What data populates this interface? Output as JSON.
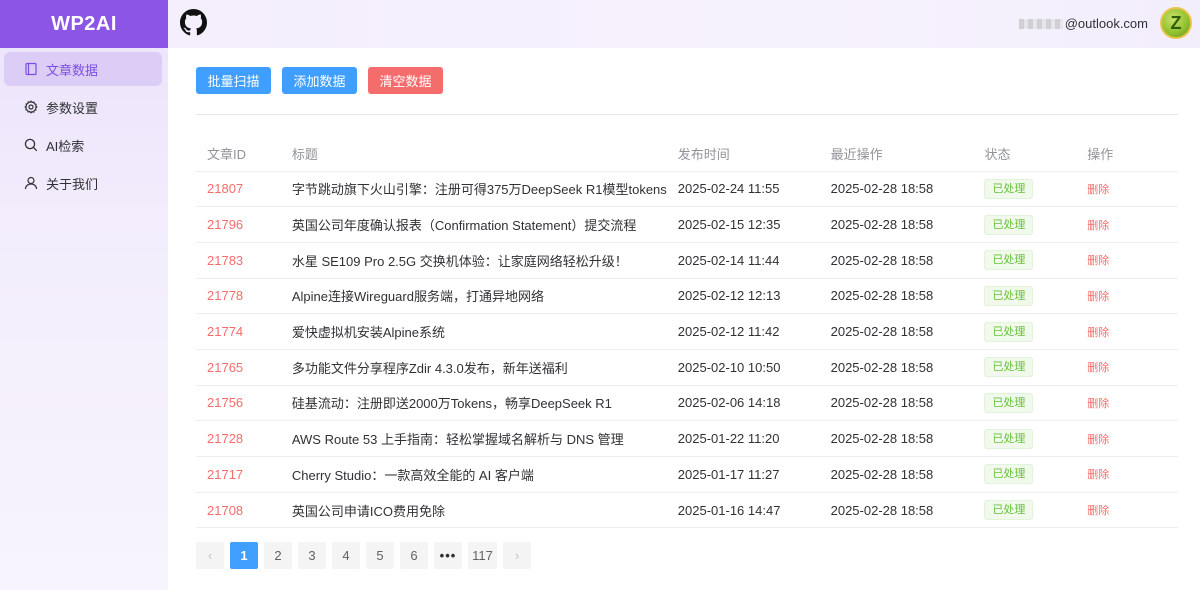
{
  "app": {
    "title": "WP2AI"
  },
  "sidebar": {
    "items": [
      {
        "label": "文章数据",
        "icon": "document-icon",
        "active": true
      },
      {
        "label": "参数设置",
        "icon": "gear-icon",
        "active": false
      },
      {
        "label": "AI检索",
        "icon": "search-icon",
        "active": false
      },
      {
        "label": "关于我们",
        "icon": "user-icon",
        "active": false
      }
    ]
  },
  "header": {
    "github_icon": "github-icon",
    "email_suffix": "@outlook.com",
    "avatar_letter": "Z"
  },
  "toolbar": {
    "batch_scan_label": "批量扫描",
    "add_data_label": "添加数据",
    "clear_data_label": "清空数据"
  },
  "table": {
    "columns": [
      "文章ID",
      "标题",
      "发布时间",
      "最近操作",
      "状态",
      "操作"
    ],
    "rows": [
      {
        "id": "21807",
        "title": "字节跳动旗下火山引擎：注册可得375万DeepSeek R1模型tokens",
        "published": "2025-02-24 11:55",
        "last_op": "2025-02-28 18:58",
        "status": "已处理",
        "action": "删除"
      },
      {
        "id": "21796",
        "title": "英国公司年度确认报表（Confirmation Statement）提交流程",
        "published": "2025-02-15 12:35",
        "last_op": "2025-02-28 18:58",
        "status": "已处理",
        "action": "删除"
      },
      {
        "id": "21783",
        "title": "水星 SE109 Pro 2.5G 交换机体验：让家庭网络轻松升级！",
        "published": "2025-02-14 11:44",
        "last_op": "2025-02-28 18:58",
        "status": "已处理",
        "action": "删除"
      },
      {
        "id": "21778",
        "title": "Alpine连接Wireguard服务端，打通异地网络",
        "published": "2025-02-12 12:13",
        "last_op": "2025-02-28 18:58",
        "status": "已处理",
        "action": "删除"
      },
      {
        "id": "21774",
        "title": "爱快虚拟机安装Alpine系统",
        "published": "2025-02-12 11:42",
        "last_op": "2025-02-28 18:58",
        "status": "已处理",
        "action": "删除"
      },
      {
        "id": "21765",
        "title": "多功能文件分享程序Zdir 4.3.0发布，新年送福利",
        "published": "2025-02-10 10:50",
        "last_op": "2025-02-28 18:58",
        "status": "已处理",
        "action": "删除"
      },
      {
        "id": "21756",
        "title": "硅基流动：注册即送2000万Tokens，畅享DeepSeek R1",
        "published": "2025-02-06 14:18",
        "last_op": "2025-02-28 18:58",
        "status": "已处理",
        "action": "删除"
      },
      {
        "id": "21728",
        "title": "AWS Route 53 上手指南：轻松掌握域名解析与 DNS 管理",
        "published": "2025-01-22 11:20",
        "last_op": "2025-02-28 18:58",
        "status": "已处理",
        "action": "删除"
      },
      {
        "id": "21717",
        "title": "Cherry Studio：一款高效全能的 AI 客户端",
        "published": "2025-01-17 11:27",
        "last_op": "2025-02-28 18:58",
        "status": "已处理",
        "action": "删除"
      },
      {
        "id": "21708",
        "title": "英国公司申请ICO费用免除",
        "published": "2025-01-16 14:47",
        "last_op": "2025-02-28 18:58",
        "status": "已处理",
        "action": "删除"
      }
    ]
  },
  "pagination": {
    "prev": "‹",
    "next": "›",
    "pages": [
      "1",
      "2",
      "3",
      "4",
      "5",
      "6"
    ],
    "ellipsis": "•••",
    "last": "117",
    "current": "1"
  },
  "colors": {
    "brand": "#8d55e6",
    "primary": "#409eff",
    "danger": "#f56c6c",
    "success": "#67c23a"
  }
}
